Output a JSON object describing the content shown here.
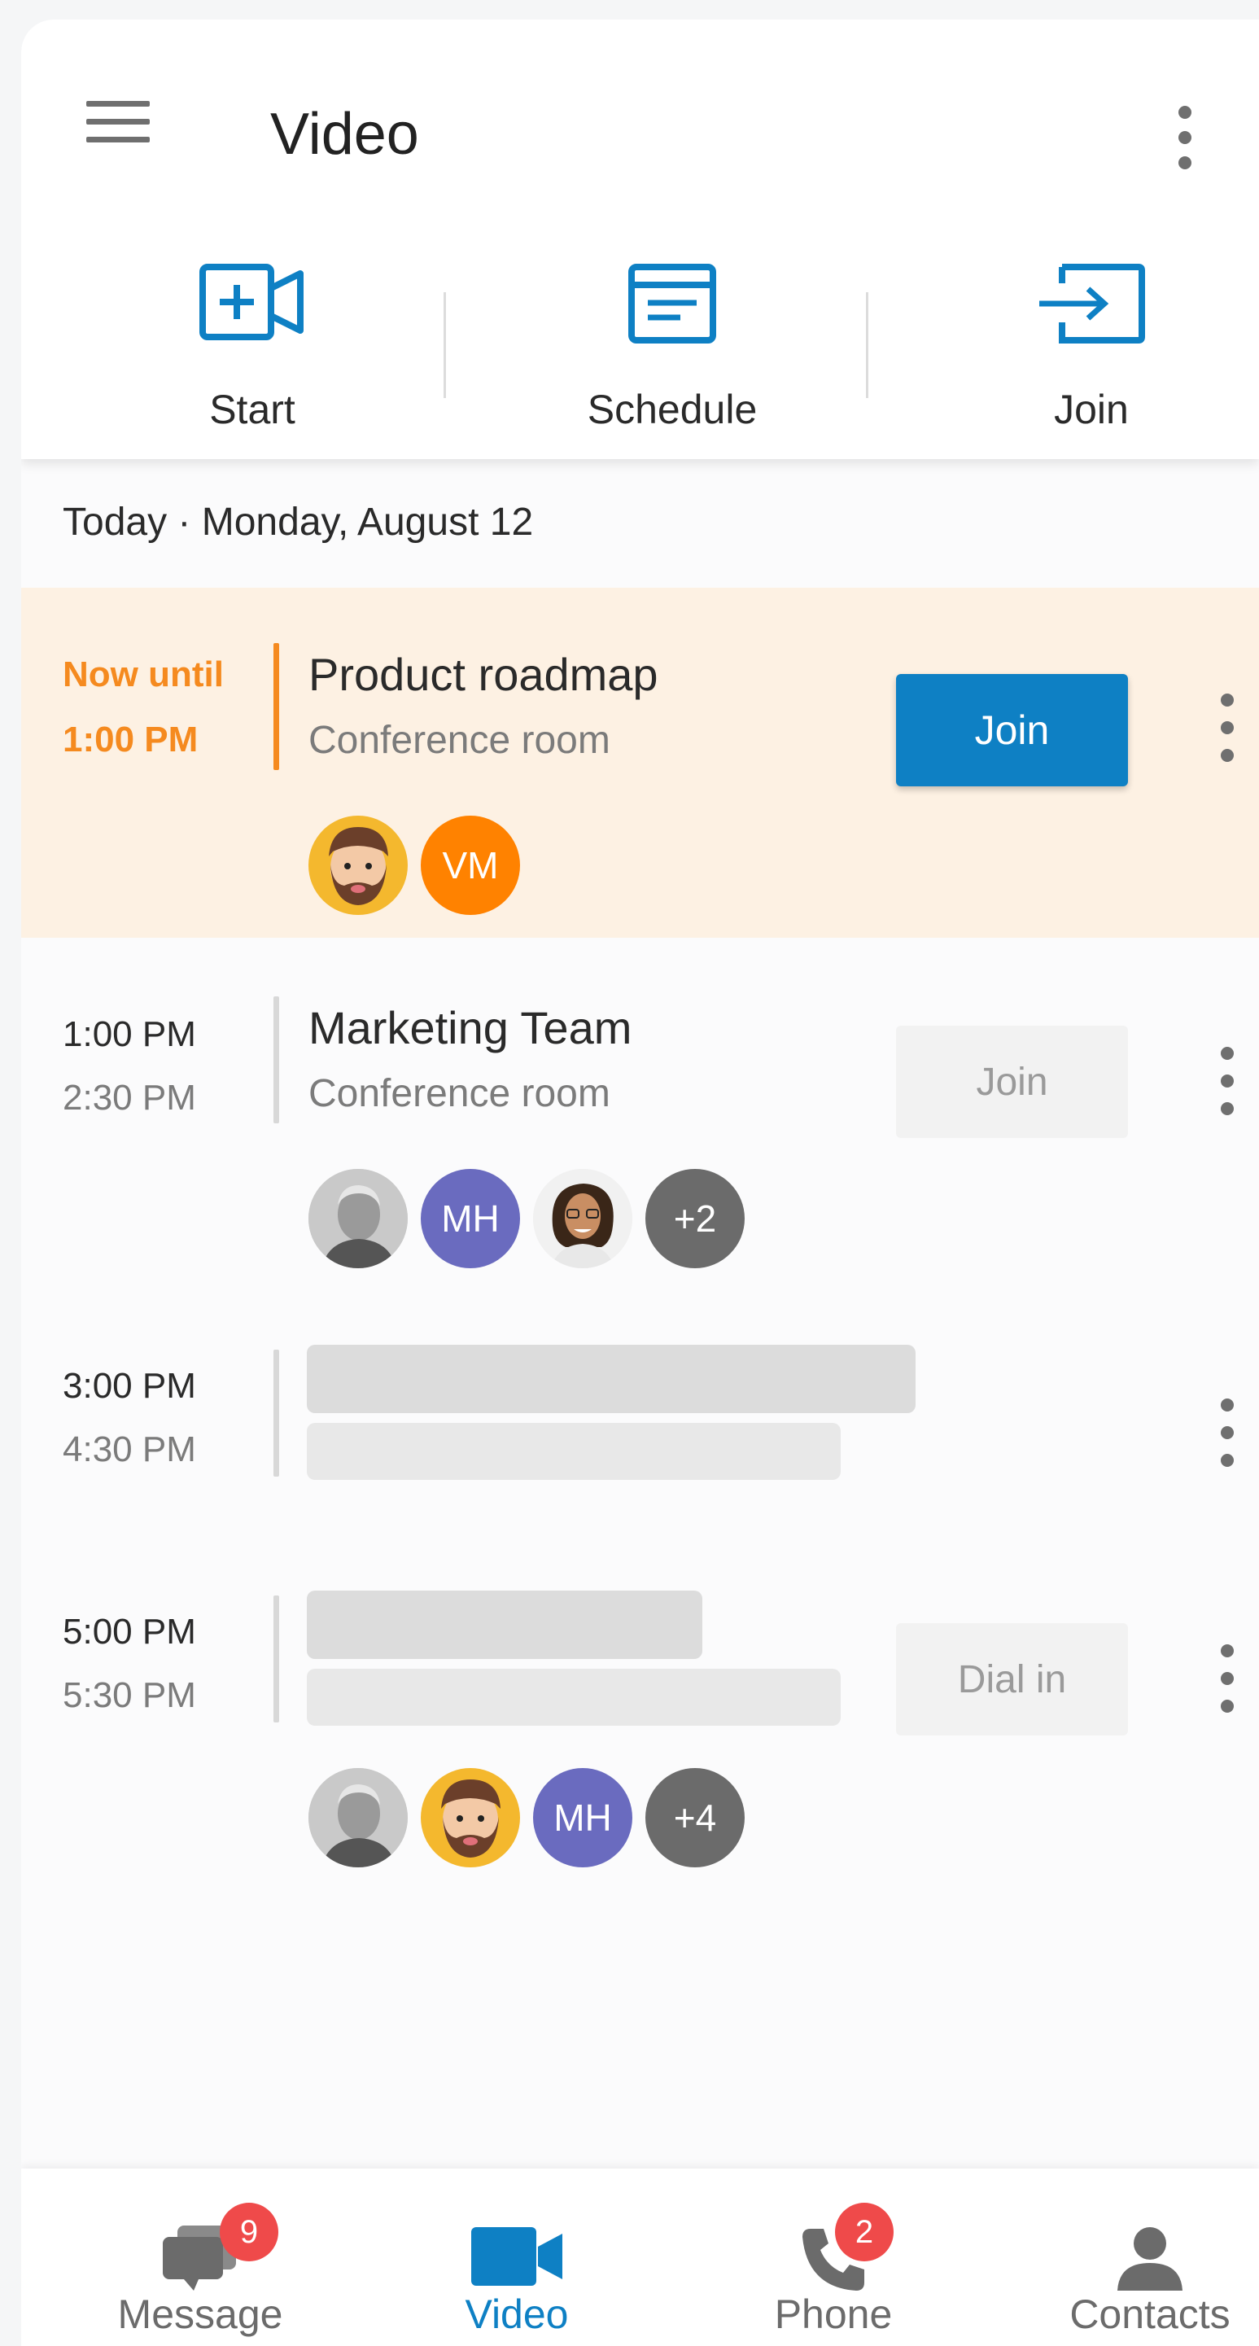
{
  "header": {
    "title": "Video",
    "actions": [
      {
        "label": "Start",
        "icon": "video-plus-icon"
      },
      {
        "label": "Schedule",
        "icon": "calendar-icon"
      },
      {
        "label": "Join",
        "icon": "join-arrow-icon"
      }
    ]
  },
  "date_label": "Today · Monday, August 12",
  "meetings": [
    {
      "start": "Now until",
      "end": "1:00 PM",
      "title": "Product roadmap",
      "location": "Conference room",
      "button": "Join",
      "active": true,
      "attendees": [
        {
          "type": "avatar-illustration",
          "name": "bearded-man"
        },
        {
          "type": "initials",
          "text": "VM",
          "color": "#ff8200"
        }
      ]
    },
    {
      "start": "1:00 PM",
      "end": "2:30 PM",
      "title": "Marketing Team",
      "location": "Conference room",
      "button": "Join",
      "active": false,
      "attendees": [
        {
          "type": "photo",
          "name": "older-man"
        },
        {
          "type": "initials",
          "text": "MH",
          "color": "#6a6bbf"
        },
        {
          "type": "photo",
          "name": "woman-glasses"
        },
        {
          "type": "count",
          "text": "+2"
        }
      ]
    },
    {
      "start": "3:00 PM",
      "end": "4:30 PM",
      "loading": true
    },
    {
      "start": "5:00 PM",
      "end": "5:30 PM",
      "loading": true,
      "button": "Dial in",
      "attendees": [
        {
          "type": "photo",
          "name": "older-man"
        },
        {
          "type": "avatar-illustration",
          "name": "bearded-man"
        },
        {
          "type": "initials",
          "text": "MH",
          "color": "#6a6bbf"
        },
        {
          "type": "count",
          "text": "+4"
        }
      ]
    }
  ],
  "bottom_nav": [
    {
      "label": "Message",
      "badge": "9",
      "active": false
    },
    {
      "label": "Video",
      "active": true
    },
    {
      "label": "Phone",
      "badge": "2",
      "active": false
    },
    {
      "label": "Contacts",
      "active": false
    }
  ],
  "colors": {
    "accent": "#0e80c4",
    "active_meeting_bg": "#fdf1e3",
    "active_meeting_accent": "#f58a1f",
    "badge": "#ef4a4a"
  }
}
